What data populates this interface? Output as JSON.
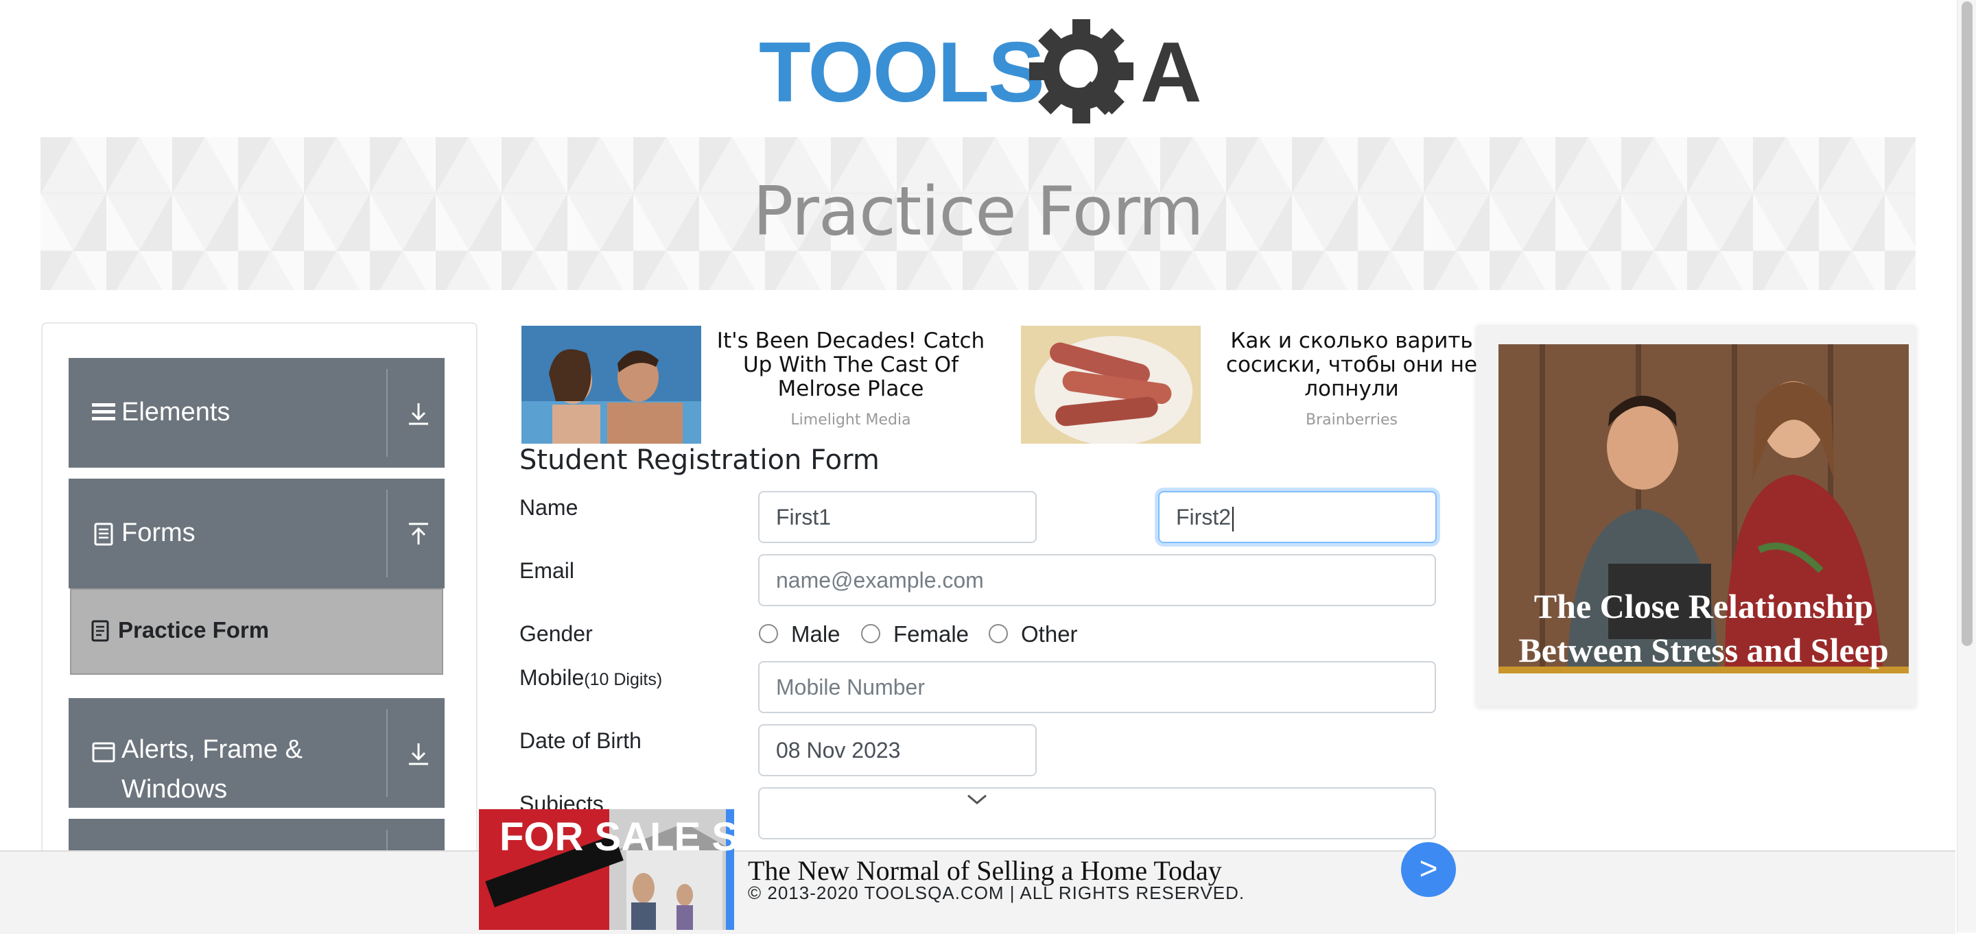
{
  "logo": {
    "text_left": "TOOLS",
    "text_right": "A",
    "alt": "TOOLSQA"
  },
  "banner": {
    "title": "Practice Form"
  },
  "sidebar": {
    "groups": [
      {
        "label": "Elements",
        "icon": "menu-icon",
        "arrow": "download-icon"
      },
      {
        "label": "Forms",
        "icon": "document-icon",
        "arrow": "upload-icon"
      },
      {
        "label_line1": "Alerts, Frame &",
        "label_line2": "Windows",
        "icon": "window-icon",
        "arrow": "download-icon"
      }
    ],
    "active_item": {
      "label": "Practice Form",
      "icon": "form-icon"
    }
  },
  "ads": [
    {
      "title": "It's Been Decades! Catch Up With The Cast Of Melrose Place",
      "source": "Limelight Media"
    },
    {
      "title": "Как и сколько варить сосиски, чтобы они не лопнули",
      "source": "Brainberries"
    }
  ],
  "form": {
    "title": "Student Registration Form",
    "name_label": "Name",
    "first_name_value": "First1",
    "last_name_value": "First2",
    "email_label": "Email",
    "email_placeholder": "name@example.com",
    "gender_label": "Gender",
    "gender_options": [
      "Male",
      "Female",
      "Other"
    ],
    "mobile_label": "Mobile",
    "mobile_hint": "(10 Digits)",
    "mobile_placeholder": "Mobile Number",
    "dob_label": "Date of Birth",
    "dob_value": "08 Nov 2023",
    "subjects_label": "Subjects"
  },
  "side_ad": {
    "caption": "The Close Relationship Between Stress and Sleep"
  },
  "footer": {
    "ad_title": "The New Normal of Selling a Home Today",
    "copyright": "© 2013-2020 TOOLSQA.COM | ALL RIGHTS RESERVED.",
    "go_label": ">",
    "ad_sign_text": "FOR SALE SOLD"
  },
  "colors": {
    "sidebar_group": "#6c757d",
    "active_item": "#b3b3b3",
    "logo_blue": "#3a90d5",
    "logo_dark": "#3a3a3a",
    "focus": "#80bdff",
    "go_button": "#3d8bf2"
  }
}
